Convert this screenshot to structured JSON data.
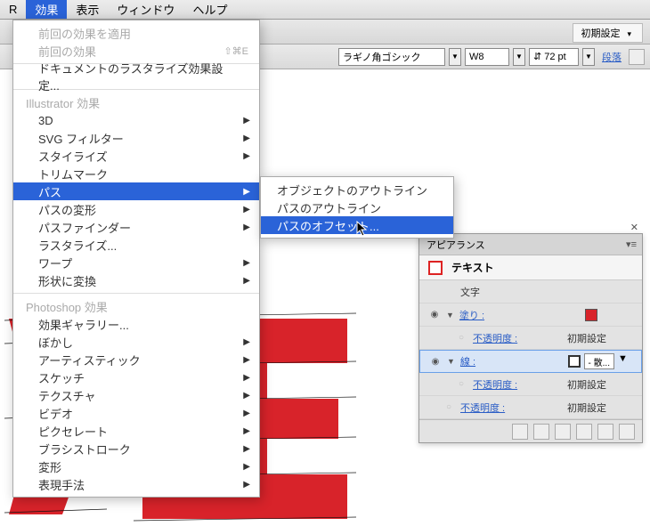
{
  "menubar": {
    "items": [
      "効果",
      "表示",
      "ウィンドウ",
      "ヘルプ"
    ]
  },
  "toolbar": {
    "preset": "初期設定"
  },
  "toolbar2": {
    "font": "ラギノ角ゴシック",
    "weight": "W8",
    "size": "72 pt",
    "para": "段落"
  },
  "menu": {
    "recent_apply": "前回の効果を適用",
    "recent": "前回の効果",
    "recent_sc": "⇧⌘E",
    "raster_settings": "ドキュメントのラスタライズ効果設定...",
    "section_ai": "Illustrator 効果",
    "items_ai": [
      {
        "l": "3D",
        "a": true
      },
      {
        "l": "SVG フィルター",
        "a": true
      },
      {
        "l": "スタイライズ",
        "a": true
      },
      {
        "l": "トリムマーク",
        "a": false
      },
      {
        "l": "パス",
        "a": true,
        "sel": true
      },
      {
        "l": "パスの変形",
        "a": true
      },
      {
        "l": "パスファインダー",
        "a": true
      },
      {
        "l": "ラスタライズ...",
        "a": false
      },
      {
        "l": "ワープ",
        "a": true
      },
      {
        "l": "形状に変換",
        "a": true
      }
    ],
    "section_ps": "Photoshop 効果",
    "items_ps": [
      {
        "l": "効果ギャラリー...",
        "a": false
      },
      {
        "l": "ぼかし",
        "a": true
      },
      {
        "l": "アーティスティック",
        "a": true
      },
      {
        "l": "スケッチ",
        "a": true
      },
      {
        "l": "テクスチャ",
        "a": true
      },
      {
        "l": "ビデオ",
        "a": true
      },
      {
        "l": "ピクセレート",
        "a": true
      },
      {
        "l": "ブラシストローク",
        "a": true
      },
      {
        "l": "変形",
        "a": true
      },
      {
        "l": "表現手法",
        "a": true
      }
    ]
  },
  "submenu": {
    "items": [
      {
        "l": "オブジェクトのアウトライン"
      },
      {
        "l": "パスのアウトライン"
      },
      {
        "l": "パスのオフセット...",
        "sel": true
      }
    ]
  },
  "panel": {
    "title": "アピアランス",
    "object": "テキスト",
    "char": "文字",
    "fill": "塗り :",
    "opacity": "不透明度 :",
    "default": "初期設定",
    "stroke": "線 :",
    "strokeval": "- 散..."
  }
}
